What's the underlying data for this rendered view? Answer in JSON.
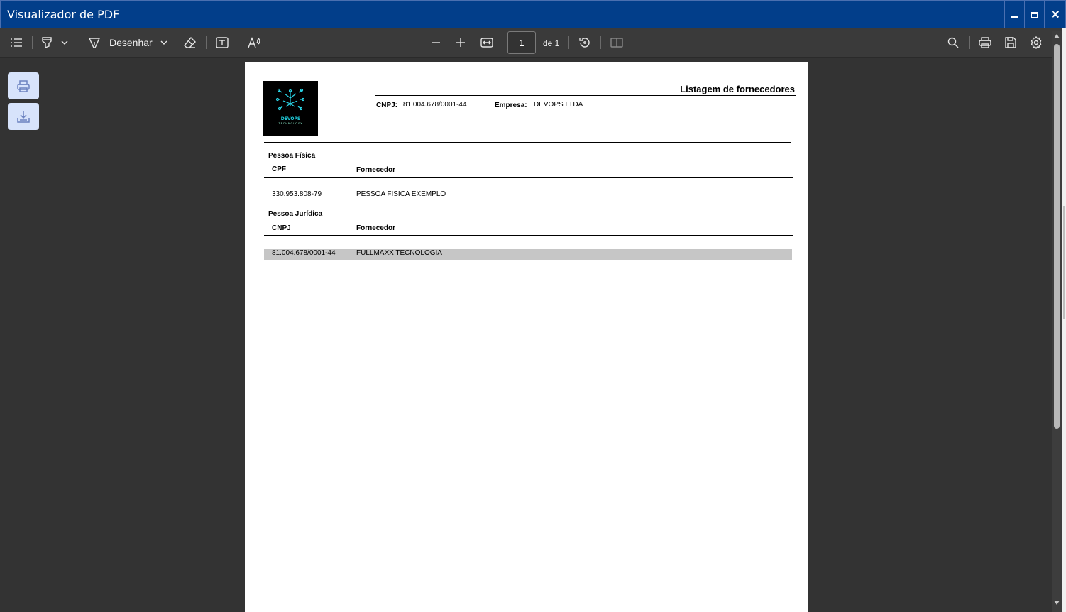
{
  "window": {
    "title": "Visualizador de PDF",
    "minimize_label": "",
    "maximize_label": "",
    "close_label": "✕"
  },
  "toolbar": {
    "draw_label": "Desenhar",
    "page_number": "1",
    "page_of": "de 1"
  },
  "icons": {
    "outline": "list-icon",
    "highlight": "highlighter-icon",
    "draw": "pen-icon",
    "erase": "eraser-icon",
    "text": "text-box-icon",
    "read_aloud": "read-aloud-icon",
    "zoom_out": "minus-icon",
    "zoom_in": "plus-icon",
    "fit": "fit-width-icon",
    "rotate": "rotate-icon",
    "two_page": "two-page-icon",
    "search": "search-icon",
    "print": "printer-icon",
    "save": "save-icon",
    "settings": "gear-icon"
  },
  "side_buttons": {
    "print": "printer-icon",
    "download": "download-icon"
  },
  "document": {
    "title": "Listagem de fornecedores",
    "logo_text": "DEVOPS",
    "logo_subtext": "TECHNOLOGY",
    "cnpj_label": "CNPJ:",
    "cnpj_value": "81.004.678/0001-44",
    "empresa_label": "Empresa:",
    "empresa_value": "DEVOPS LTDA",
    "sections": [
      {
        "title": "Pessoa Física",
        "col1": "CPF",
        "col2": "Fornecedor",
        "rows": [
          {
            "id": "330.953.808-79",
            "name": "PESSOA FÍSICA EXEMPLO"
          }
        ]
      },
      {
        "title": "Pessoa Jurídica",
        "col1": "CNPJ",
        "col2": "Fornecedor",
        "rows": [
          {
            "id": "81.004.678/0001-44",
            "name": "FULLMAXX TECNOLOGIA"
          }
        ]
      }
    ]
  },
  "colors": {
    "titlebar": "#023e8a",
    "toolbar": "#3a3a3a",
    "background": "#333333",
    "side_button": "#d7e3fb",
    "highlight_row": "#c6c6c6"
  }
}
